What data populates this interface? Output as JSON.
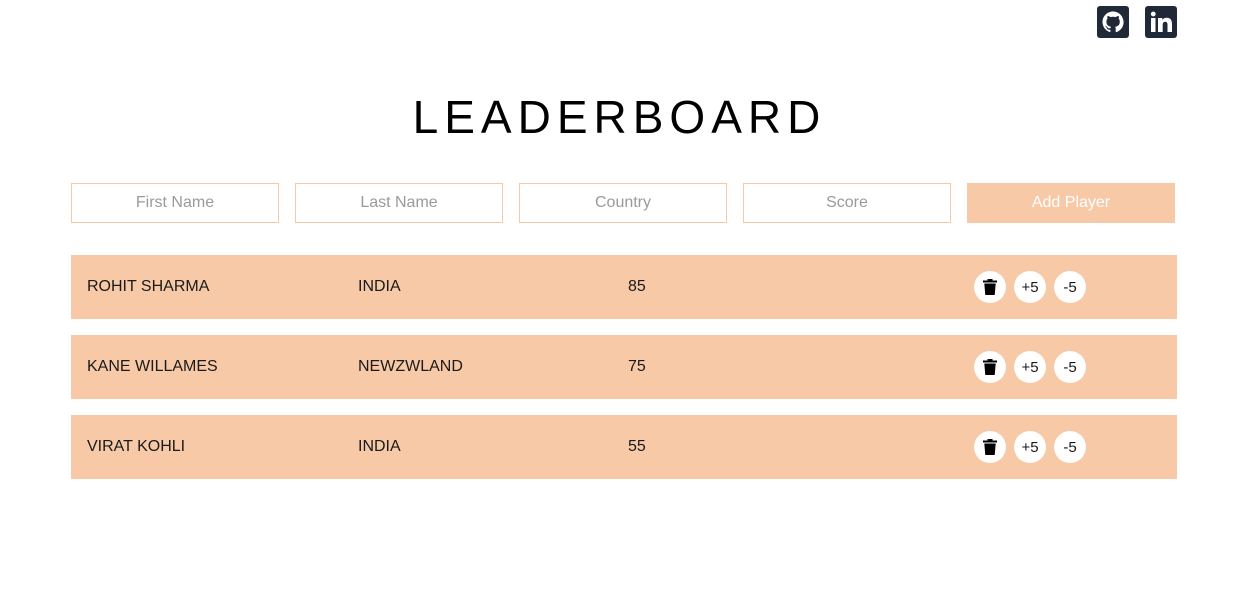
{
  "header": {
    "title": "LEADERBOARD",
    "social": [
      "github-icon",
      "linkedin-icon"
    ]
  },
  "form": {
    "first_name_placeholder": "First Name",
    "last_name_placeholder": "Last Name",
    "country_placeholder": "Country",
    "score_placeholder": "Score",
    "add_label": "Add Player"
  },
  "players": [
    {
      "name": "ROHIT SHARMA",
      "country": "INDIA",
      "score": "85"
    },
    {
      "name": "KANE WILLAMES",
      "country": "NEWZWLAND",
      "score": "75"
    },
    {
      "name": "VIRAT KOHLI",
      "country": "INDIA",
      "score": "55"
    }
  ],
  "row_actions": {
    "delete_icon": "trash-icon",
    "plus_label": "+5",
    "minus_label": "-5"
  },
  "colors": {
    "accent": "#f7c9a7",
    "icon_bg": "#1f2937"
  }
}
